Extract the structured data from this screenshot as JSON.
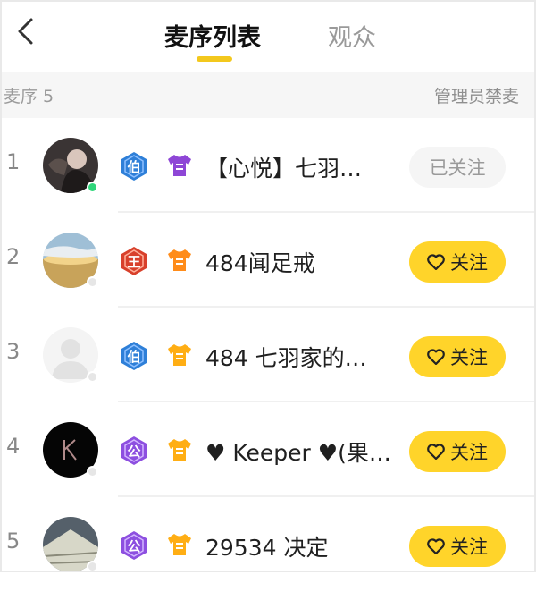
{
  "header": {
    "tabs": [
      {
        "label": "麦序列表",
        "active": true
      },
      {
        "label": "观众",
        "active": false
      }
    ]
  },
  "subbar": {
    "queue_label": "麦序 5",
    "admin_label": "管理员禁麦"
  },
  "queue": [
    {
      "index": "1",
      "badge1_text": "伯",
      "badge1_color": "#2e7fd8",
      "badge2_icon": "cloth-icon",
      "badge2_color": "#8e46d6",
      "name": "【心悦】七羽…",
      "online": true,
      "button": "已关注",
      "followed": true
    },
    {
      "index": "2",
      "badge1_text": "王",
      "badge1_color": "#d8402b",
      "badge2_icon": "cloth-icon",
      "badge2_color": "#ff8c1a",
      "name": "484闻足戒",
      "online": false,
      "button": "关注",
      "followed": false
    },
    {
      "index": "3",
      "badge1_text": "伯",
      "badge1_color": "#2e7fd8",
      "badge2_icon": "cloth-icon",
      "badge2_color": "#ffae14",
      "name": "484  七羽家的…",
      "online": false,
      "button": "关注",
      "followed": false
    },
    {
      "index": "4",
      "badge1_text": "公",
      "badge1_color": "#8d4fe0",
      "badge2_icon": "cloth-icon",
      "badge2_color": "#ffae14",
      "name": "♥ Keeper ♥(果…",
      "online": false,
      "button": "关注",
      "followed": false
    },
    {
      "index": "5",
      "badge1_text": "公",
      "badge1_color": "#8d4fe0",
      "badge2_icon": "cloth-icon",
      "badge2_color": "#ffae14",
      "name": "29534 决定",
      "online": false,
      "button": "关注",
      "followed": false
    }
  ],
  "colors": {
    "accent": "#ffd42a",
    "online": "#2fd67a"
  }
}
